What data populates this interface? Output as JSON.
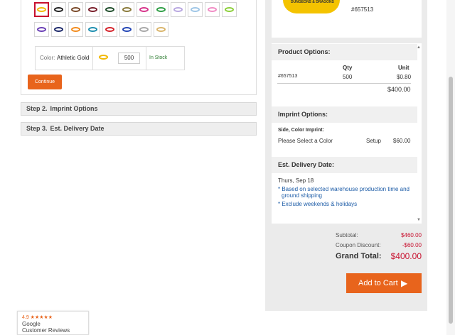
{
  "swatches": {
    "row1": [
      {
        "name": "athletic-gold",
        "color": "#f1b800",
        "selected": true
      },
      {
        "name": "black",
        "color": "#222222"
      },
      {
        "name": "brown",
        "color": "#7a4a2a"
      },
      {
        "name": "maroon",
        "color": "#7a1f2b"
      },
      {
        "name": "dark-green",
        "color": "#1f4d2b"
      },
      {
        "name": "olive",
        "color": "#8a7a3a"
      },
      {
        "name": "magenta",
        "color": "#d6338a"
      },
      {
        "name": "green",
        "color": "#2e9e45"
      },
      {
        "name": "lavender",
        "color": "#b8a7e0"
      },
      {
        "name": "light-blue",
        "color": "#9fc6e6"
      },
      {
        "name": "pink",
        "color": "#f08cc4"
      },
      {
        "name": "lime",
        "color": "#8ccf3a"
      }
    ],
    "row2": [
      {
        "name": "purple",
        "color": "#6a3fb5"
      },
      {
        "name": "navy",
        "color": "#1e2a6b"
      },
      {
        "name": "orange",
        "color": "#f28c1e"
      },
      {
        "name": "teal",
        "color": "#1f8fb0"
      },
      {
        "name": "red",
        "color": "#d4222a"
      },
      {
        "name": "royal-blue",
        "color": "#2346b5"
      },
      {
        "name": "silver",
        "color": "#a8a8a8"
      },
      {
        "name": "tan",
        "color": "#d9b46a"
      }
    ]
  },
  "color_selection": {
    "label": "Color:",
    "value": "Athletic Gold",
    "quantity": "500",
    "stock": "In Stock"
  },
  "continue_label": "Continue",
  "steps": [
    {
      "num": "Step 2.",
      "title": "Imprint Options"
    },
    {
      "num": "Step 3.",
      "title": "Est. Delivery Date"
    }
  ],
  "product": {
    "sku": "#657513",
    "logo_text": "DUNGEONS & DRAGONS"
  },
  "product_options": {
    "heading": "Product Options:",
    "qty_header": "Qty",
    "unit_header": "Unit",
    "sku": "#657513",
    "qty": "500",
    "unit": "$0.80",
    "line_total": "$400.00"
  },
  "imprint_options": {
    "heading": "Imprint Options:",
    "side_label": "Side, Color Imprint:",
    "select_text": "Please Select a Color",
    "setup_label": "Setup",
    "setup_price": "$60.00"
  },
  "delivery": {
    "heading": "Est. Delivery Date:",
    "date": "Thurs, Sep 18",
    "note1_line1": "* Based on selected warehouse production time and",
    "note1_line2": "ground shipping",
    "note2": "* Exclude weekends & holidays"
  },
  "totals": {
    "subtotal_label": "Subtotal:",
    "subtotal": "$460.00",
    "coupon_label": "Coupon Discount:",
    "coupon": "-$60.00",
    "grand_label": "Grand Total:",
    "grand": "$400.00"
  },
  "add_to_cart_label": "Add to Cart",
  "google_badge": {
    "rating": "4.9 ★★★★★",
    "line1": "Google",
    "line2": "Customer Reviews"
  }
}
